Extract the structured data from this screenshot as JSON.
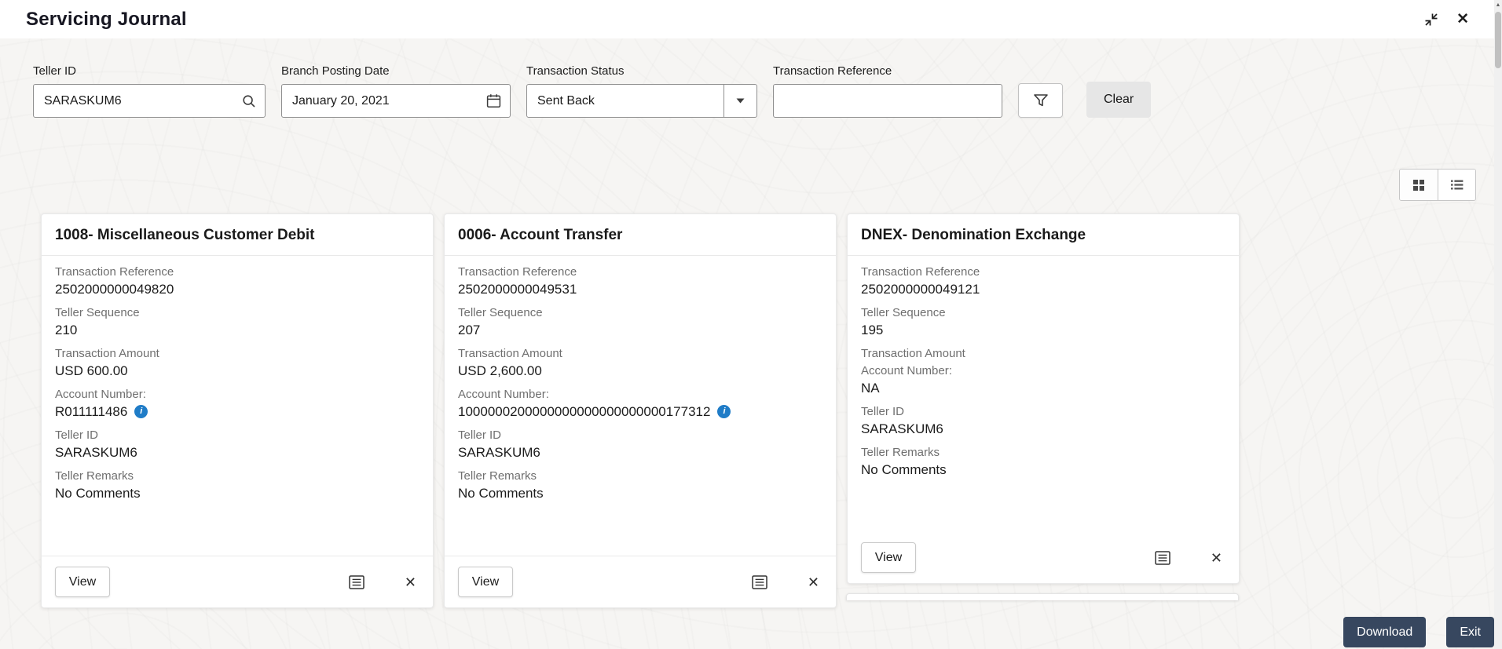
{
  "header": {
    "title": "Servicing Journal"
  },
  "filters": {
    "teller_id": {
      "label": "Teller ID",
      "value": "SARASKUM6"
    },
    "branch_posting_date": {
      "label": "Branch Posting Date",
      "value": "January 20, 2021"
    },
    "transaction_status": {
      "label": "Transaction Status",
      "value": "Sent Back"
    },
    "transaction_reference": {
      "label": "Transaction Reference",
      "value": ""
    },
    "clear_label": "Clear"
  },
  "view_toggle": {
    "active": "grid"
  },
  "card_labels": {
    "transaction_reference": "Transaction Reference",
    "teller_sequence": "Teller Sequence",
    "transaction_amount": "Transaction Amount",
    "account_number": "Account Number:",
    "teller_id": "Teller ID",
    "teller_remarks": "Teller Remarks",
    "view_button": "View"
  },
  "cards": [
    {
      "title": "1008- Miscellaneous Customer Debit",
      "transaction_reference": "2502000000049820",
      "teller_sequence": "210",
      "transaction_amount": "USD 600.00",
      "account_number": "R011111486",
      "teller_id": "SARASKUM6",
      "teller_remarks": "No Comments"
    },
    {
      "title": "0006- Account Transfer",
      "transaction_reference": "2502000000049531",
      "teller_sequence": "207",
      "transaction_amount": "USD 2,600.00",
      "account_number": "1000000200000000000000000000177312",
      "teller_id": "SARASKUM6",
      "teller_remarks": "No Comments"
    },
    {
      "title": "DNEX- Denomination Exchange",
      "transaction_reference": "2502000000049121",
      "teller_sequence": "195",
      "transaction_amount": "",
      "account_number": "NA",
      "teller_id": "SARASKUM6",
      "teller_remarks": "No Comments"
    }
  ],
  "icons": {
    "close": "✕",
    "card_close": "✕",
    "info": "i"
  },
  "actions": {
    "download": "Download",
    "exit": "Exit"
  },
  "colors": {
    "info_blue": "#1f7cc7",
    "action_dark": "#37475f",
    "page_bg": "#f6f5f3"
  }
}
